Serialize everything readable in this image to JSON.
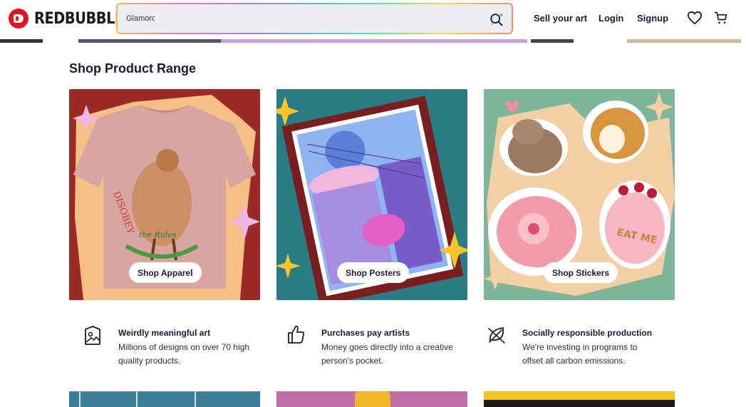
{
  "header": {
    "brand": "REDBUBBLE",
    "search": {
      "value": "Glamorc"
    },
    "nav": {
      "sell": "Sell your art",
      "login": "Login",
      "signup": "Signup"
    },
    "icons": [
      "heart-icon",
      "cart-icon",
      "search-icon"
    ]
  },
  "section": {
    "title": "Shop Product Range",
    "cards": [
      {
        "label": "Shop Apparel",
        "color": "#9b2a25"
      },
      {
        "label": "Shop Posters",
        "color": "#2a7c84"
      },
      {
        "label": "Shop Stickers",
        "color": "#7fb59a"
      }
    ]
  },
  "tshirt_art": {
    "word_top": "DISOBEY",
    "word_bottom": "the Rules"
  },
  "sticker_art": {
    "cake_text": "EAT ME"
  },
  "value_props": [
    {
      "icon": "image-frame-icon",
      "title": "Weirdly meaningful art",
      "desc_line1": "Millions of designs on over 70 high",
      "desc_line2": "quality products."
    },
    {
      "icon": "thumbs-up-icon",
      "title": "Purchases pay artists",
      "desc_line1": "Money goes directly into a creative",
      "desc_line2": "person's pocket."
    },
    {
      "icon": "leaf-icon",
      "title": "Socially responsible production",
      "desc_line1": "We're investing in programs to",
      "desc_line2": "offset all carbon emissions."
    }
  ],
  "colors": {
    "brand_red": "#e41321",
    "text_dark": "#1a1a3a"
  }
}
